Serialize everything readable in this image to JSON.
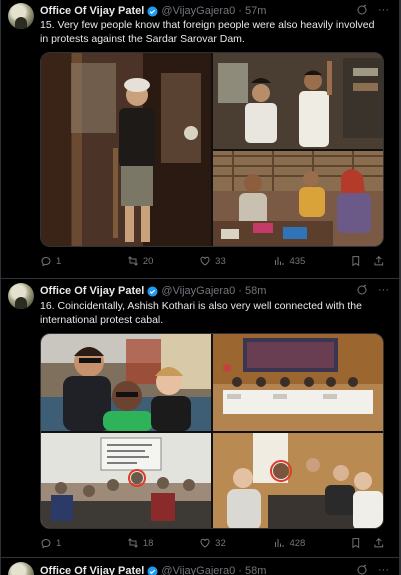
{
  "tweets": [
    {
      "author": "Office Of Vijay Patel",
      "handle": "@VijayGajera0",
      "time": "57m",
      "text": "15. Very few people know that foreign people were also heavily involved in protests against the Sardar Sarovar Dam.",
      "stats": {
        "replies": "1",
        "retweets": "20",
        "likes": "33",
        "views": "435"
      }
    },
    {
      "author": "Office Of Vijay Patel",
      "handle": "@VijayGajera0",
      "time": "58m",
      "text": "16. Coincidentally, Ashish Kothari is also very well connected with the international protest cabal.",
      "stats": {
        "replies": "1",
        "retweets": "18",
        "likes": "32",
        "views": "428"
      }
    },
    {
      "author": "Office Of Vijay Patel",
      "handle": "@VijayGajera0",
      "time": "58m"
    }
  ],
  "separator": "·",
  "colors": {
    "background": "#000000",
    "text": "#e7e9ea",
    "muted": "#71767b",
    "verified": "#1d9bf0",
    "border": "#2f3336"
  }
}
